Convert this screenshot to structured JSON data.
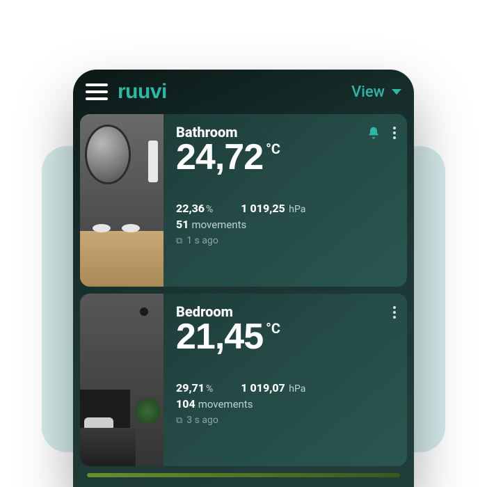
{
  "header": {
    "logo": "ruuvi",
    "view_label": "View"
  },
  "sensors": [
    {
      "name": "Bathroom",
      "temperature": "24,72",
      "temperature_unit": "°C",
      "humidity": "22,36",
      "humidity_unit": "%",
      "pressure": "1 019,25",
      "pressure_unit": "hPa",
      "movements": "51",
      "movements_label": "movements",
      "ago": "1 s ago",
      "has_alert": true
    },
    {
      "name": "Bedroom",
      "temperature": "21,45",
      "temperature_unit": "°C",
      "humidity": "29,71",
      "humidity_unit": "%",
      "pressure": "1 019,07",
      "pressure_unit": "hPa",
      "movements": "104",
      "movements_label": "movements",
      "ago": "3 s ago",
      "has_alert": false
    }
  ]
}
